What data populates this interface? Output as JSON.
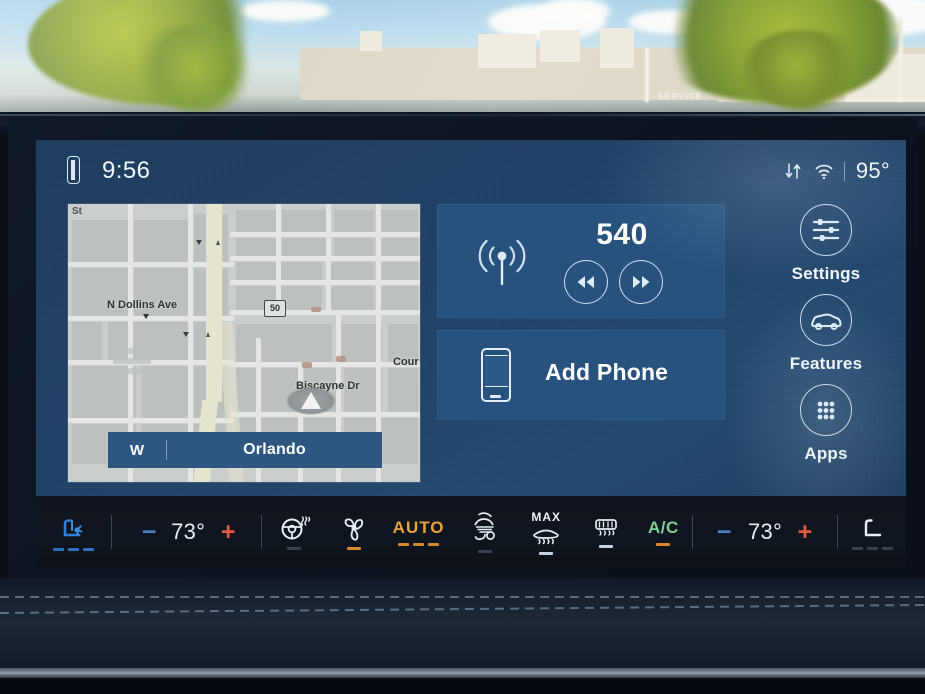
{
  "scene": {
    "environment": "windshield-reflection",
    "reflected_sign_text": "SERVICE"
  },
  "status_bar": {
    "brand_icon": "lincoln-badge-icon",
    "clock": "9:56",
    "icons": [
      "data-transfer-icon",
      "wifi-icon"
    ],
    "outside_temperature": "95°"
  },
  "map": {
    "corner_label": "St",
    "highway_shield": "50",
    "street_labels": [
      "N Dollins Ave",
      "Biscayne Dr",
      "Cour"
    ],
    "vehicle_marker": "navigation-arrow-icon",
    "destination_bar": {
      "direction": "W",
      "location": "Orlando"
    }
  },
  "media_tile": {
    "source_icon": "radio-broadcast-icon",
    "frequency": "540",
    "prev_icon": "skip-previous-icon",
    "next_icon": "skip-next-icon"
  },
  "phone_tile": {
    "icon": "mobile-phone-icon",
    "label": "Add Phone"
  },
  "sidebar": {
    "items": [
      {
        "label": "Settings",
        "icon": "sliders-icon"
      },
      {
        "label": "Features",
        "icon": "car-icon"
      },
      {
        "label": "Apps",
        "icon": "grid-dots-icon"
      }
    ]
  },
  "climate": {
    "driver_seat": {
      "icon": "ventilated-seat-icon",
      "state": "cooling-active"
    },
    "driver_temp": {
      "minus": "−",
      "value": "73°",
      "plus": "+"
    },
    "steering_wheel": {
      "icon": "heated-steering-wheel-icon"
    },
    "fan": {
      "icon": "fan-icon"
    },
    "auto": {
      "label": "AUTO"
    },
    "airflow": {
      "icon": "airflow-face-feet-icon"
    },
    "front_defrost": {
      "label": "MAX",
      "icon": "front-defrost-icon"
    },
    "rear_defrost": {
      "icon": "rear-defrost-icon"
    },
    "ac": {
      "label": "A/C"
    },
    "passenger_temp": {
      "minus": "−",
      "value": "73°",
      "plus": "+"
    },
    "passenger_seat": {
      "icon": "seat-icon",
      "state": "off"
    }
  },
  "colors": {
    "screen_bg": "#1d4066",
    "tile_bg": "#27527e",
    "accent_amber": "#e8a13c",
    "accent_green": "#7fcf8e",
    "accent_blue": "#4a7fc1",
    "accent_red": "#e05a3c",
    "text_primary": "#f0f5fa",
    "dest_bar": "#2d5680"
  }
}
